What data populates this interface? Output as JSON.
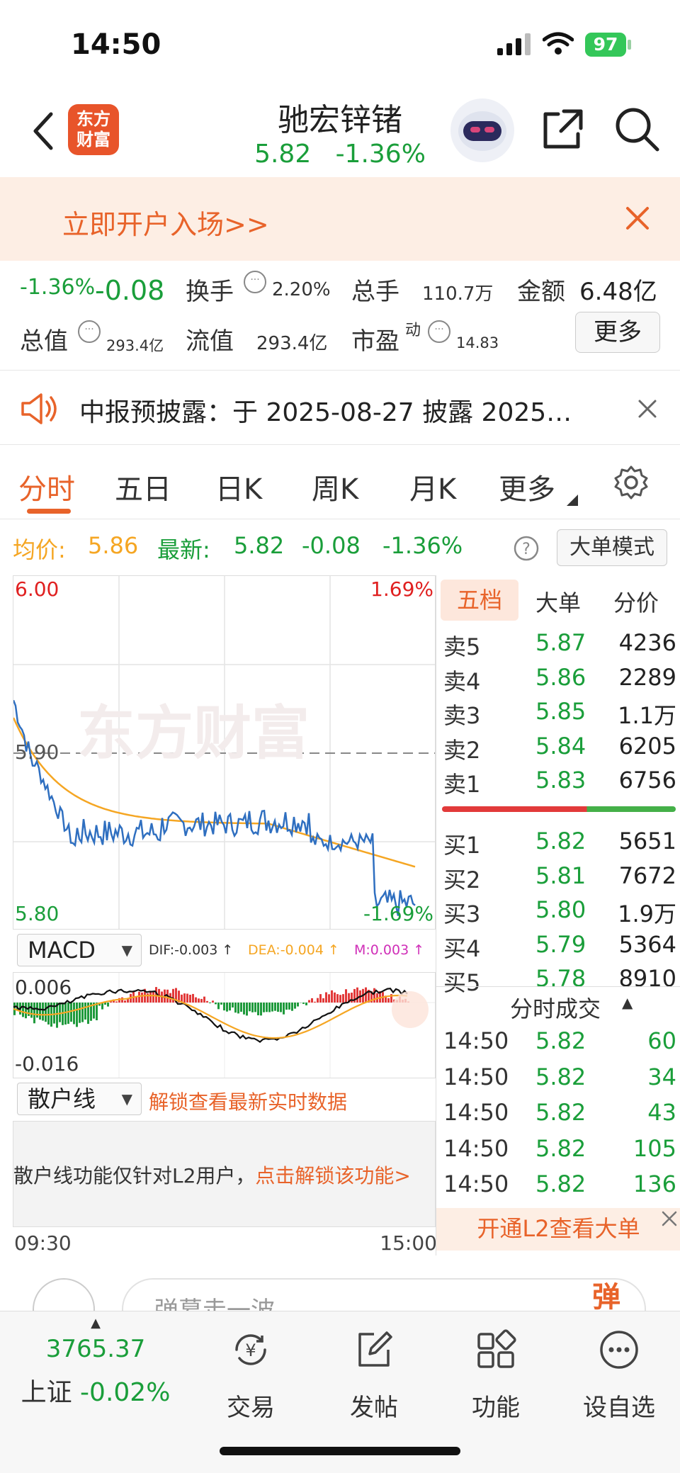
{
  "status_bar": {
    "time": "14:50",
    "battery": "97"
  },
  "header": {
    "logo_line1": "东方",
    "logo_line2": "财富",
    "stock_name": "驰宏锌锗",
    "price": "5.82",
    "change_pct": "-1.36%"
  },
  "banner": {
    "text": "立即开户入场>>"
  },
  "stats": {
    "change_pct": "-1.36%",
    "change_abs": "-0.08",
    "turnover_label": "换手",
    "turnover_value": "2.20%",
    "volume_label": "总手",
    "volume_value": "110.7万",
    "amount_label": "金额",
    "amount_value": "6.48亿",
    "mcap_label": "总值",
    "mcap_value": "293.4亿",
    "float_label": "流值",
    "float_value": "293.4亿",
    "pe_label": "市盈",
    "pe_sup": "动",
    "pe_value": "14.83",
    "more_button": "更多"
  },
  "notice": {
    "text": "中报预披露：于 2025-08-27 披露 2025…"
  },
  "tabs": [
    "分时",
    "五日",
    "日K",
    "周K",
    "月K",
    "更多"
  ],
  "price_line": {
    "avg_label": "均价:",
    "avg_value": "5.86",
    "latest_label": "最新:",
    "latest_value": "5.82",
    "latest_change": "-0.08",
    "latest_pct": "-1.36%",
    "big_order_mode": "大单模式"
  },
  "chart": {
    "top_price": "6.00",
    "top_pct": "1.69%",
    "mid_price": "5.90",
    "bottom_price": "5.80",
    "bottom_pct": "-1.69%",
    "watermark": "东方财富",
    "start_time": "09:30",
    "end_time": "15:00"
  },
  "macd": {
    "selector": "MACD",
    "dif": "DIF:-0.003 ↑",
    "dea": "DEA:-0.004 ↑",
    "m": "M:0.003 ↑",
    "top_value": "0.006",
    "bottom_value": "-0.016"
  },
  "retail": {
    "selector": "散户线",
    "unlock_text": "解锁查看最新实时数据",
    "notice_text": "散户线功能仅针对L2用户，",
    "notice_link": "点击解锁该功能>"
  },
  "order_book": {
    "tabs": [
      "五档",
      "大单",
      "分价"
    ],
    "asks": [
      {
        "label": "卖5",
        "price": "5.87",
        "volume": "4236"
      },
      {
        "label": "卖4",
        "price": "5.86",
        "volume": "2289"
      },
      {
        "label": "卖3",
        "price": "5.85",
        "volume": "1.1万"
      },
      {
        "label": "卖2",
        "price": "5.84",
        "volume": "6205"
      },
      {
        "label": "卖1",
        "price": "5.83",
        "volume": "6756"
      }
    ],
    "bids": [
      {
        "label": "买1",
        "price": "5.82",
        "volume": "5651"
      },
      {
        "label": "买2",
        "price": "5.81",
        "volume": "7672"
      },
      {
        "label": "买3",
        "price": "5.80",
        "volume": "1.9万"
      },
      {
        "label": "买4",
        "price": "5.79",
        "volume": "5364"
      },
      {
        "label": "买5",
        "price": "5.78",
        "volume": "8910"
      }
    ],
    "ticks_title": "分时成交",
    "ticks": [
      {
        "time": "14:50",
        "price": "5.82",
        "volume": "60"
      },
      {
        "time": "14:50",
        "price": "5.82",
        "volume": "34"
      },
      {
        "time": "14:50",
        "price": "5.82",
        "volume": "43"
      },
      {
        "time": "14:50",
        "price": "5.82",
        "volume": "105"
      },
      {
        "time": "14:50",
        "price": "5.82",
        "volume": "136"
      }
    ],
    "l2_button": "开通L2查看大单"
  },
  "comment": {
    "placeholder": "弹幕走一波",
    "send": "弹"
  },
  "bottom_nav": {
    "index_value": "3765.37",
    "index_name": "上证",
    "index_change": "-0.02%",
    "items": [
      "交易",
      "发帖",
      "功能",
      "设自选"
    ]
  },
  "colors": {
    "up": "#e02020",
    "down": "#1a9e3a",
    "accent": "#e8632a",
    "avg_line": "#f5a623",
    "price_line": "#2f6fc0"
  }
}
